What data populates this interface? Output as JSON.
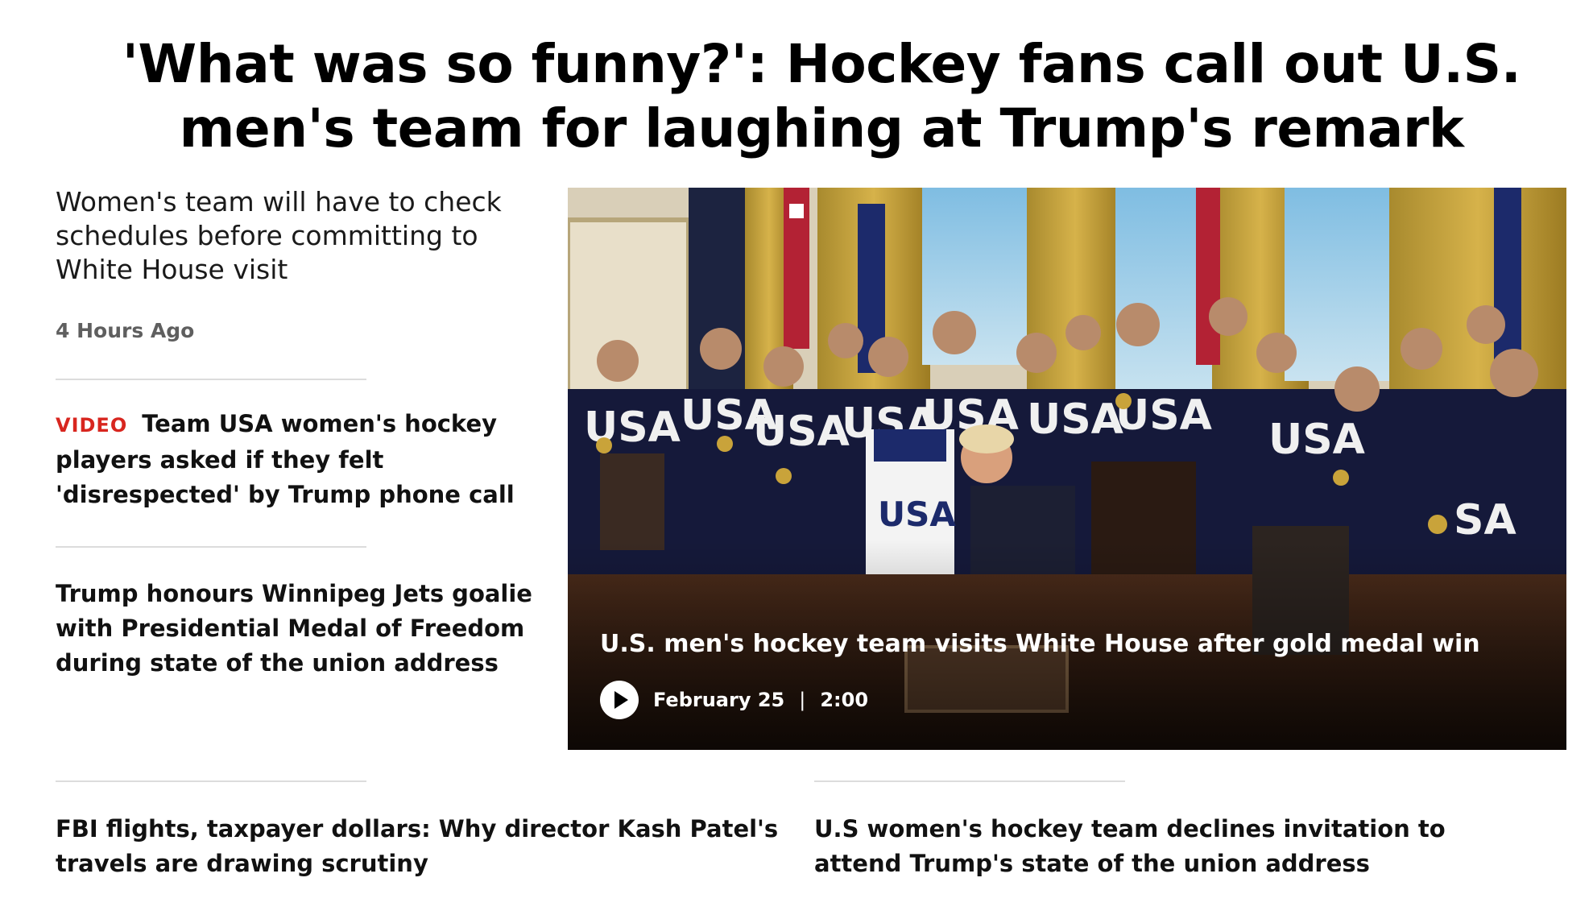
{
  "article": {
    "headline": "'What was so funny?': Hockey fans call out U.S. men's team for laughing at Trump's remark",
    "deck": "Women's team will have to check schedules before committing to White House visit",
    "timestamp": "4 Hours Ago"
  },
  "related": [
    {
      "tag": "VIDEO",
      "title": "Team USA women's hockey players asked if they felt 'disrespected' by Trump phone call"
    },
    {
      "tag": "",
      "title": "Trump honours Winnipeg Jets goalie with Presidential Medal of Freedom during state of the union address"
    }
  ],
  "hero": {
    "caption": "U.S. men's hockey team visits White House after gold medal win",
    "date": "February 25",
    "separator": "|",
    "duration": "2:00",
    "play_icon": "play-icon"
  },
  "bottom_stories": [
    {
      "title": "FBI flights, taxpayer dollars: Why director Kash Patel's travels are drawing scrutiny"
    },
    {
      "title": "U.S women's hockey team declines invitation to attend Trump's state of the union address"
    }
  ],
  "colors": {
    "video_tag": "#d8261f",
    "divider": "#dcdcdc",
    "timestamp": "#5f5f5f"
  }
}
